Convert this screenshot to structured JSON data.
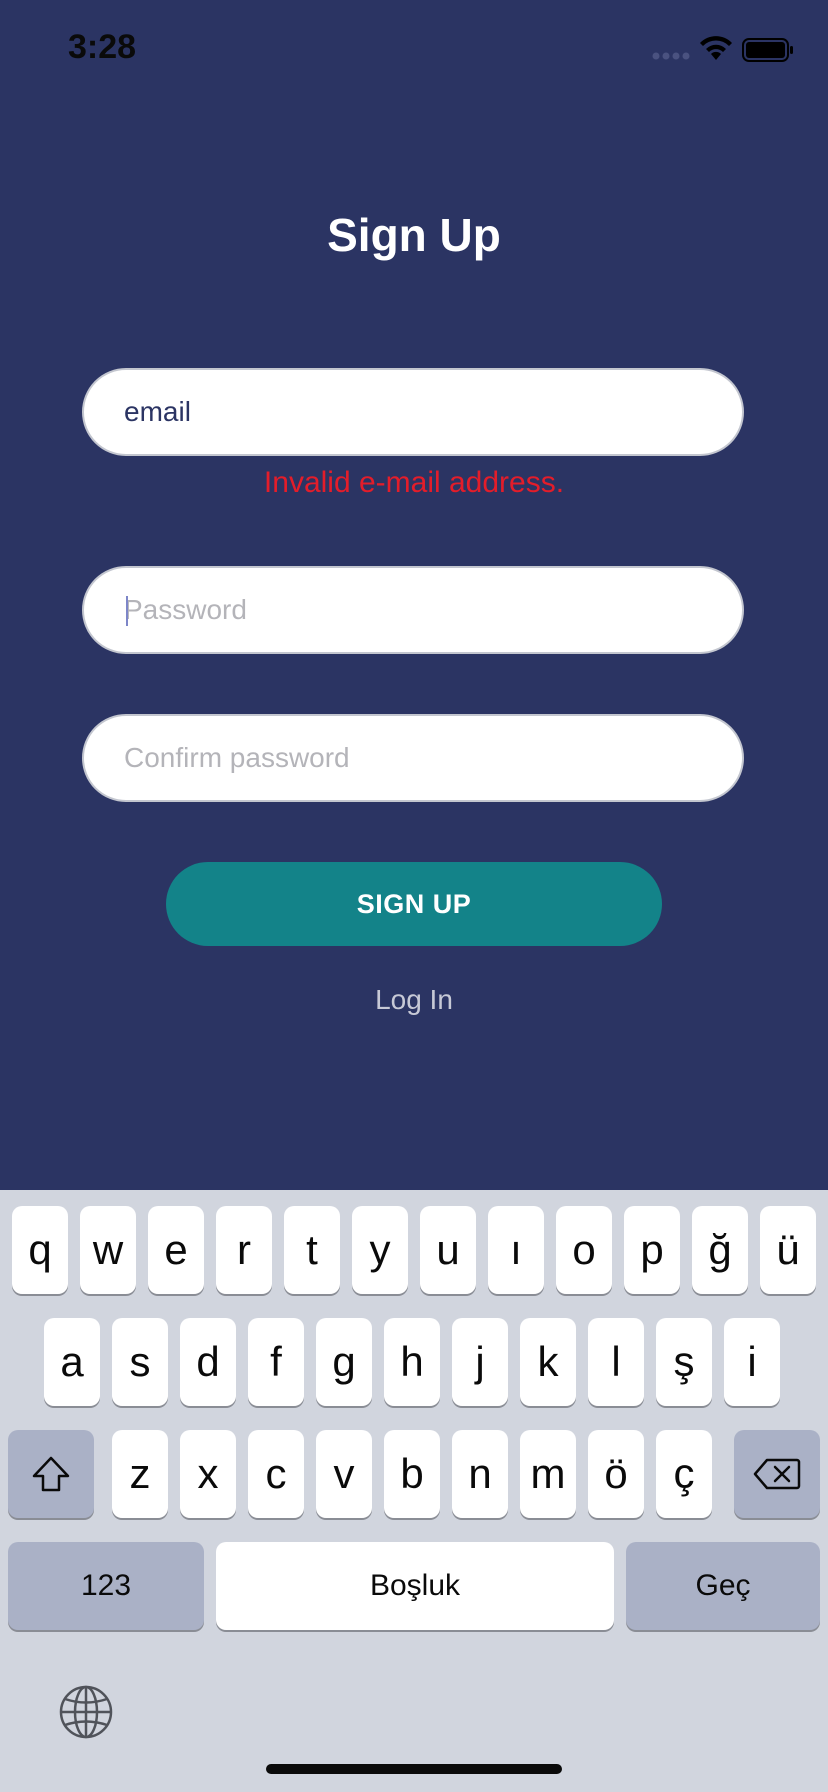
{
  "status_bar": {
    "time": "3:28"
  },
  "title": "Sign Up",
  "form": {
    "email": {
      "value": "email",
      "placeholder": ""
    },
    "email_error": "Invalid e-mail address.",
    "password": {
      "value": "",
      "placeholder": "Password"
    },
    "confirm_password": {
      "value": "",
      "placeholder": "Confirm password"
    },
    "submit_label": "SIGN UP",
    "login_link": "Log In"
  },
  "keyboard": {
    "row1": [
      "q",
      "w",
      "e",
      "r",
      "t",
      "y",
      "u",
      "ı",
      "o",
      "p",
      "ğ",
      "ü"
    ],
    "row2": [
      "a",
      "s",
      "d",
      "f",
      "g",
      "h",
      "j",
      "k",
      "l",
      "ş",
      "i"
    ],
    "row3": [
      "z",
      "x",
      "c",
      "v",
      "b",
      "n",
      "m",
      "ö",
      "ç"
    ],
    "numbers_key": "123",
    "space_key": "Boşluk",
    "return_key": "Geç"
  },
  "colors": {
    "background": "#2b3463",
    "accent": "#138389",
    "error": "#e31d2a"
  }
}
